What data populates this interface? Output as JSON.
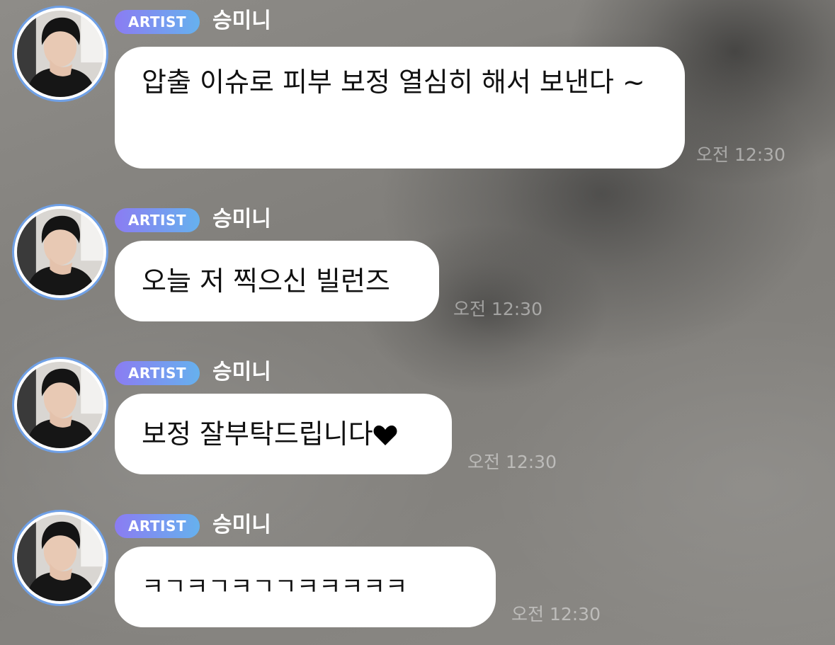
{
  "messages": [
    {
      "badge": "ARTIST",
      "sender": "승미니",
      "text": "압출 이슈로 피부 보정 열심히 해서 보낸다 ~",
      "time": "오전 12:30"
    },
    {
      "badge": "ARTIST",
      "sender": "승미니",
      "text": "오늘 저 찍으신 빌런즈",
      "time": "오전 12:30"
    },
    {
      "badge": "ARTIST",
      "sender": "승미니",
      "text": "보정 잘부탁드립니다",
      "time": "오전 12:30"
    },
    {
      "badge": "ARTIST",
      "sender": "승미니",
      "text": "ㅋㄱㅋㄱㅋㄱㄱㅋㅋㅋㅋㅋ",
      "time": "오전 12:30"
    }
  ],
  "icons": {
    "heart": "heart-icon",
    "avatar": "profile-photo"
  },
  "colors": {
    "badge_start": "#8b7cf2",
    "badge_end": "#66b1ee",
    "avatar_ring": "#6fa0e6",
    "bubble": "#ffffff"
  }
}
